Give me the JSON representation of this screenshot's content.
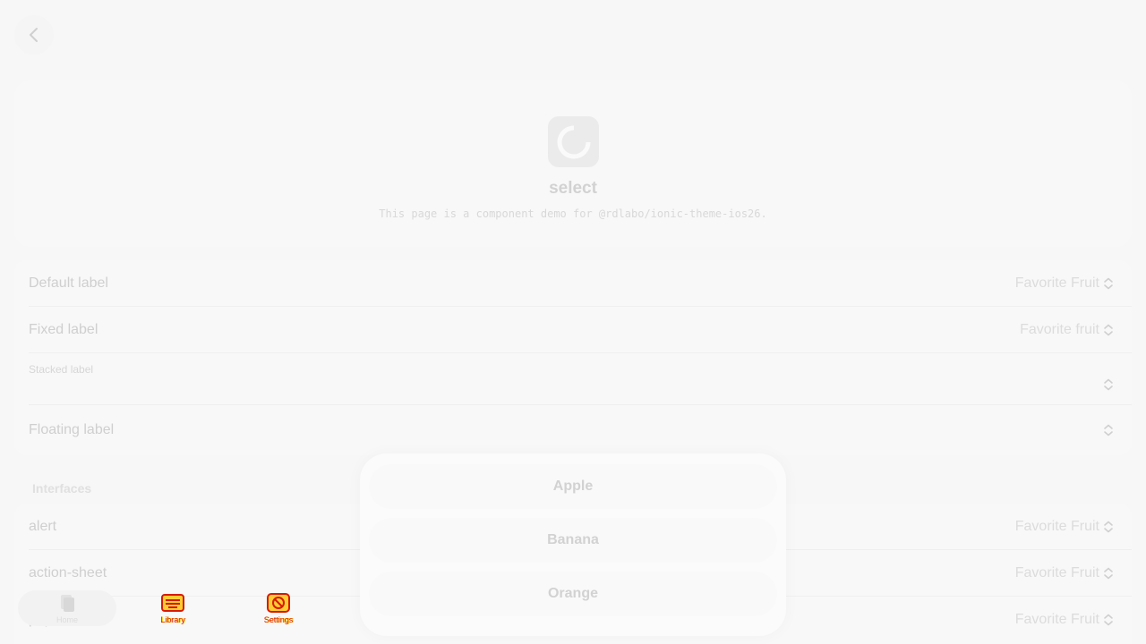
{
  "hero": {
    "title": "select",
    "subtitle": "This page is a component demo for @rdlabo/ionic-theme-ios26."
  },
  "labels_list": [
    {
      "label": "Default label",
      "value": "Favorite Fruit"
    },
    {
      "label": "Fixed label",
      "value": "Favorite fruit"
    },
    {
      "label": "Stacked label",
      "value": ""
    },
    {
      "label": "Floating label",
      "value": ""
    }
  ],
  "interfaces": {
    "heading": "Interfaces",
    "rows": [
      {
        "label": "alert",
        "value": "Favorite Fruit"
      },
      {
        "label": "action-sheet",
        "value": "Favorite Fruit"
      },
      {
        "label": "popover",
        "value": "Favorite Fruit"
      }
    ]
  },
  "popover_options": [
    "Apple",
    "Banana",
    "Orange"
  ],
  "tabs": [
    {
      "label": "Home",
      "icon": "documents-icon"
    },
    {
      "label": "Library",
      "icon": "library-icon"
    },
    {
      "label": "Settings",
      "icon": "settings-icon"
    }
  ],
  "colors": {
    "background": "#f7f7f7",
    "tab_active_text": "#d81a00"
  }
}
